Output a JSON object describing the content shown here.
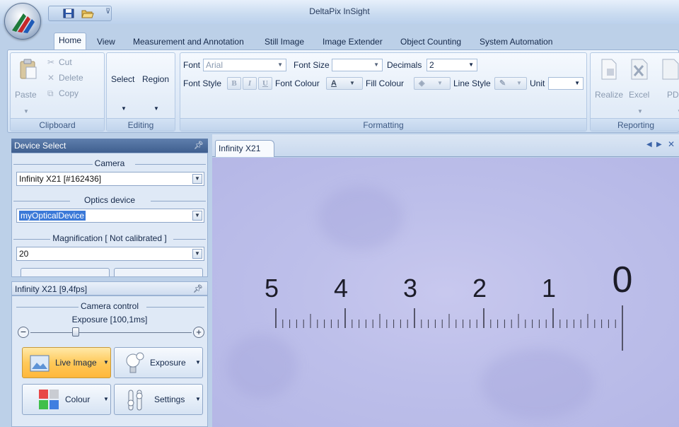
{
  "app": {
    "title": "DeltaPix InSight"
  },
  "tabs": [
    "Home",
    "View",
    "Measurement and Annotation",
    "Still Image",
    "Image Extender",
    "Object Counting",
    "System Automation"
  ],
  "ribbon": {
    "clipboard": {
      "label": "Clipboard",
      "paste": "Paste",
      "cut": "Cut",
      "delete": "Delete",
      "copy": "Copy"
    },
    "editing": {
      "label": "Editing",
      "select": "Select",
      "region": "Region"
    },
    "formatting": {
      "label": "Formatting",
      "font_label": "Font",
      "font_value": "Arial",
      "font_size_label": "Font Size",
      "font_size_value": "",
      "decimals_label": "Decimals",
      "decimals_value": "2",
      "font_style_label": "Font Style",
      "bold": "B",
      "italic": "I",
      "underline": "U",
      "font_colour_label": "Font Colour",
      "fill_colour_label": "Fill Colour",
      "line_style_label": "Line Style",
      "unit_label": "Unit",
      "unit_value": ""
    },
    "reporting": {
      "label": "Reporting",
      "realize": "Realize",
      "excel": "Excel",
      "pdf": "PD"
    }
  },
  "device_select": {
    "title": "Device Select",
    "camera_legend": "Camera",
    "camera_value": "Infinity X21  [#162436]",
    "optics_legend": "Optics device",
    "optics_value": "myOpticalDevice",
    "magnification_legend": "Magnification [ Not calibrated ]",
    "magnification_value": "20"
  },
  "camera_panel": {
    "title": "Infinity X21    [9,4fps]",
    "control_legend": "Camera control",
    "exposure_label": "Exposure [100,1ms]",
    "exposure_level": 0.28,
    "live_image": "Live Image",
    "exposure_btn": "Exposure",
    "colour_btn": "Colour",
    "settings_btn": "Settings"
  },
  "document": {
    "tab": "Infinity X21"
  },
  "ruler": {
    "numbers": [
      "5",
      "4",
      "3",
      "2",
      "1",
      "0"
    ]
  },
  "colors": {
    "accent": "#3f5f8f",
    "live_button": "#ffc95a",
    "viewport": "#bdbfea"
  }
}
